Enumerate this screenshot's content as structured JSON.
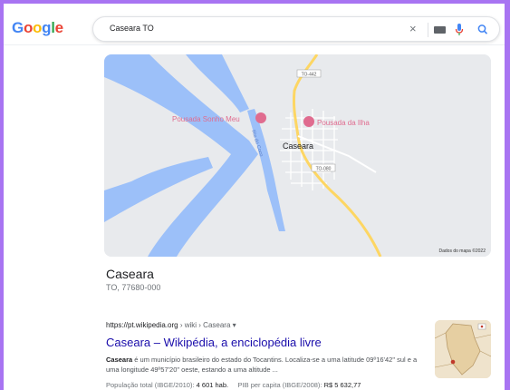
{
  "header": {
    "logo_letters": [
      {
        "ch": "G",
        "color": "#4285f4"
      },
      {
        "ch": "o",
        "color": "#ea4335"
      },
      {
        "ch": "o",
        "color": "#fbbc05"
      },
      {
        "ch": "g",
        "color": "#4285f4"
      },
      {
        "ch": "l",
        "color": "#34a853"
      },
      {
        "ch": "e",
        "color": "#ea4335"
      }
    ],
    "search_value": "Caseara TO",
    "clear_glyph": "×"
  },
  "map": {
    "labels": {
      "pousada_sonho_meu": "Pousada Sonho Meu",
      "pousada_da_ilha": "Pousada da Ilha",
      "town": "Caseara",
      "river": "Rio do Coco",
      "road_top": "TO-442",
      "road_mid": "TO-080",
      "attribution": "Dados do mapa ©2022"
    },
    "colors": {
      "land": "#e8eaed",
      "water": "#9cc0f9",
      "road": "#fdd663",
      "poi": "#e06c8f"
    }
  },
  "place": {
    "title": "Caseara",
    "address": "TO, 77680-000"
  },
  "result": {
    "url_host": "https://pt.wikipedia.org",
    "url_path": " › wiki › Caseara",
    "url_menu": " ▾",
    "title": "Caseara – Wikipédia, a enciclopédia livre",
    "snippet_bold": "Caseara",
    "snippet_rest": " é um município brasileiro do estado do Tocantins. Localiza-se a uma latitude 09º16'42\" sul e a uma longitude 49º57'20\" oeste, estando a uma altitude ...",
    "fact1_label": "População total (IBGE/2010): ",
    "fact1_value": "4 601 hab.",
    "fact2_label": "PIB per capita (IBGE/2008): ",
    "fact2_value": "R$ 5 632,77"
  }
}
